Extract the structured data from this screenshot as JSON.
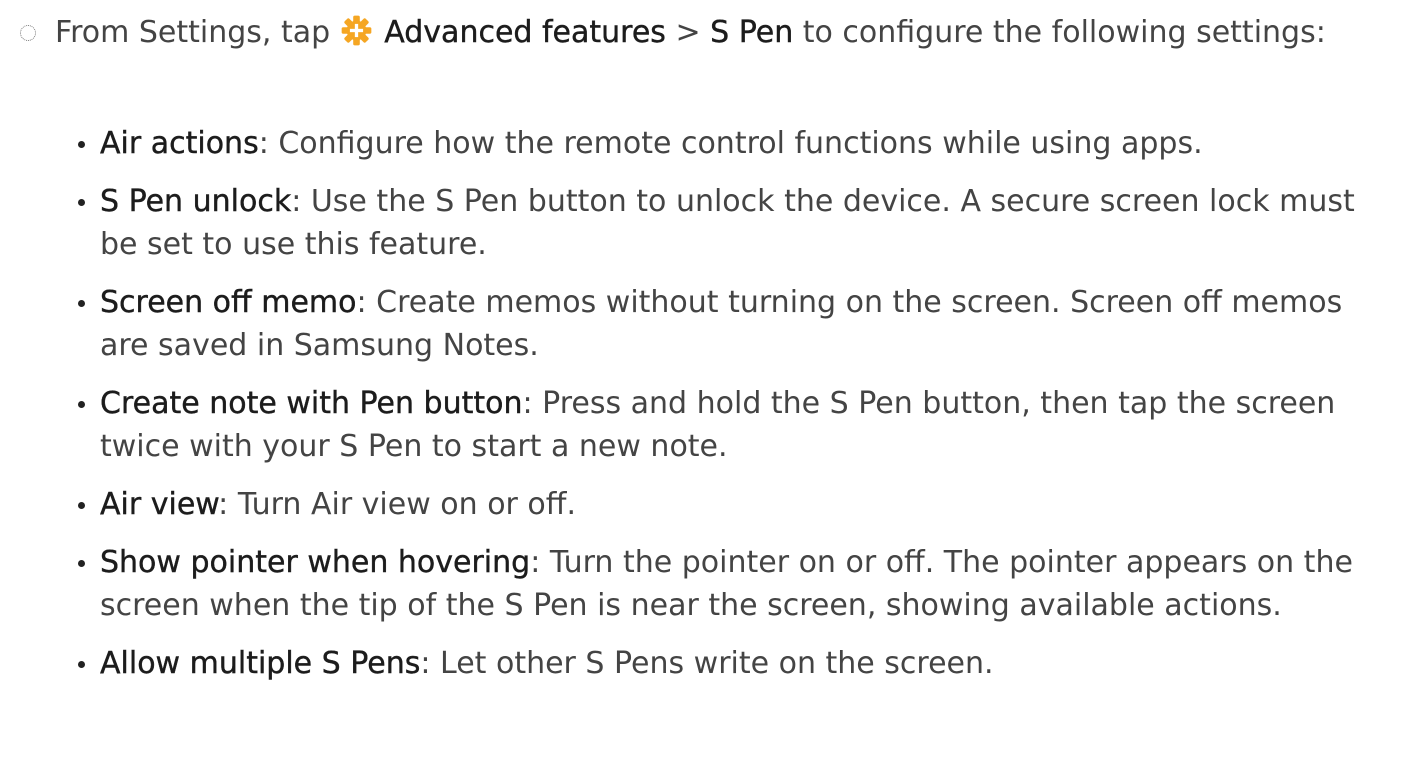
{
  "intro": {
    "prefix": "From Settings, tap ",
    "icon": "advanced-features-gear-icon",
    "icon_color": "#F5A623",
    "path_part1": "Advanced features",
    "separator": " > ",
    "path_part2": "S Pen",
    "suffix": " to configure the following settings:"
  },
  "settings": [
    {
      "term": "Air actions",
      "description": ": Configure how the remote control functions while using apps."
    },
    {
      "term": "S Pen unlock",
      "description": ": Use the S Pen button to unlock the device. A secure screen lock must be set to use this feature."
    },
    {
      "term": "Screen off memo",
      "description": ": Create memos without turning on the screen. Screen off memos are saved in Samsung Notes."
    },
    {
      "term": "Create note with Pen button",
      "description": ": Press and hold the S Pen button, then tap the screen twice with your S Pen to start a new note."
    },
    {
      "term": "Air view",
      "description": ": Turn Air view on or off."
    },
    {
      "term": "Show pointer when hovering",
      "description": ": Turn the pointer on or off. The pointer appears on the screen when the tip of the S Pen is near the screen, showing available actions."
    },
    {
      "term": "Allow multiple S Pens",
      "description": ": Let other S Pens write on the screen."
    }
  ]
}
